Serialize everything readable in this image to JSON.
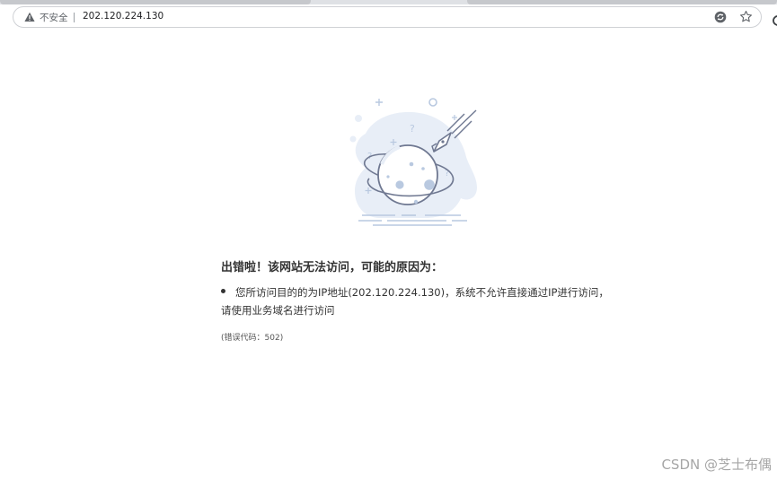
{
  "browser": {
    "security_label": "不安全",
    "url": "202.120.224.130",
    "icons": {
      "warning": "warning-triangle-icon",
      "translate": "translate-icon",
      "bookmark": "star-icon"
    }
  },
  "error": {
    "heading": "出错啦！该网站无法访问，可能的原因为：",
    "reason_line_1": "您所访问目的的为IP地址(202.120.224.130)，系统不允许直接通过IP进行访问，",
    "reason_line_2": "请使用业务域名进行访问",
    "code_text": "(错误代码：502)"
  },
  "watermark": "CSDN @芝士布偶",
  "colors": {
    "illustration_fill": "#e8eef7",
    "illustration_stroke": "#6f7891",
    "illustration_accent": "#b9c9e0",
    "text": "#333333"
  }
}
